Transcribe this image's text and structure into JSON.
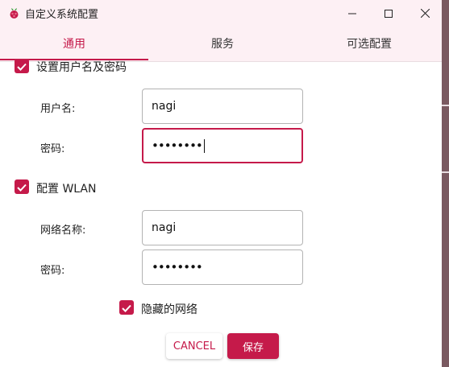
{
  "window": {
    "title": "自定义系统配置",
    "app_icon": "raspberry-icon",
    "controls": [
      "minimize-icon",
      "maximize-icon",
      "close-icon"
    ]
  },
  "tabs": [
    {
      "label": "通用",
      "active": true
    },
    {
      "label": "服务",
      "active": false
    },
    {
      "label": "可选配置",
      "active": false
    }
  ],
  "user_section": {
    "checkbox_label": "设置用户名及密码",
    "checked": true,
    "username_label": "用户名:",
    "username_value": "nagi",
    "password_label": "密码:",
    "password_value": "••••••••"
  },
  "wlan_section": {
    "checkbox_label": "配置 WLAN",
    "checked": true,
    "ssid_label": "网络名称:",
    "ssid_value": "nagi",
    "password_label": "密码:",
    "password_value": "••••••••",
    "hidden_label": "隐藏的网络",
    "hidden_checked": true
  },
  "buttons": {
    "cancel": "CANCEL",
    "save": "保存"
  },
  "colors": {
    "accent": "#c51a4a",
    "titlebar": "#fdf0f4"
  }
}
